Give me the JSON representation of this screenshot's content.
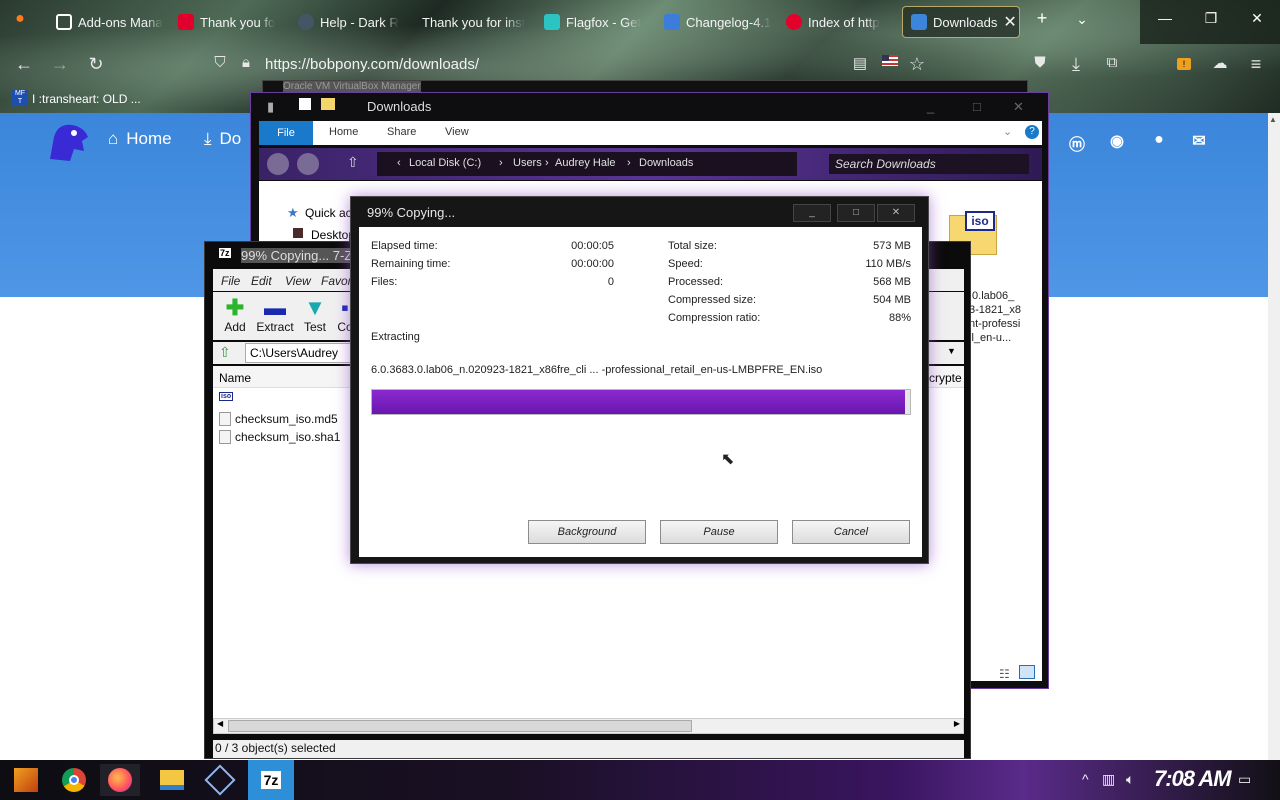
{
  "browser": {
    "tabs": [
      {
        "label": "Add-ons Mana",
        "icon": "puzzle-icon",
        "color": "#9aa0a6"
      },
      {
        "label": "Thank you fo",
        "icon": "shield-icon",
        "color": "#e0002b"
      },
      {
        "label": "Help - Dark R",
        "icon": "darkreader-icon",
        "color": "#556677"
      },
      {
        "label": "Thank you for inst",
        "icon": "blank-icon",
        "color": "transparent"
      },
      {
        "label": "Flagfox - Get",
        "icon": "fox-icon",
        "color": "#2cc3c3"
      },
      {
        "label": "Changelog-4.1",
        "icon": "image-icon",
        "color": "#3c7dd9"
      },
      {
        "label": "Index of http",
        "icon": "oracle-icon",
        "color": "#e4002b"
      },
      {
        "label": "Downloads",
        "icon": "bobpony-icon",
        "color": "#3b86db",
        "active": true
      }
    ],
    "url": "https://bobpony.com/downloads/",
    "bookmark": "I :transheart: OLD ...",
    "downloads_badge": "!"
  },
  "website": {
    "nav_home": "Home",
    "nav_downloads": "Do",
    "social": [
      "mastodon-icon",
      "discord-icon",
      "github-icon",
      "mail-icon"
    ]
  },
  "background_window": {
    "title": "Oracle VM VirtualBox Manager"
  },
  "explorer": {
    "title": "Downloads",
    "ribbon_tabs": [
      "File",
      "Home",
      "Share",
      "View"
    ],
    "breadcrumb": [
      "Local Disk (C:)",
      "Users",
      "Audrey Hale",
      "Downloads"
    ],
    "search_placeholder": "Search Downloads",
    "nav_items": [
      "Quick ac",
      "Desktop"
    ],
    "file_label_lines": [
      ".0.lab06_",
      "3-1821_x8",
      "nt-professi",
      "il_en-u..."
    ]
  },
  "sevenzip_fm": {
    "title": "99% Copying... 7-Z",
    "menu": [
      "File",
      "Edit",
      "View",
      "Favor"
    ],
    "tools": [
      "Add",
      "Extract",
      "Test",
      "Co"
    ],
    "path": "C:\\Users\\Audrey",
    "column_name": "Name",
    "column_right": "crypte",
    "files": [
      "checksum_iso.md5",
      "checksum_iso.sha1"
    ],
    "status": "0 / 3 object(s) selected"
  },
  "copy_dialog": {
    "title": "99% Copying...",
    "elapsed_label": "Elapsed time:",
    "elapsed_value": "00:00:05",
    "remaining_label": "Remaining time:",
    "remaining_value": "00:00:00",
    "files_label": "Files:",
    "files_value": "0",
    "total_label": "Total size:",
    "total_value": "573 MB",
    "speed_label": "Speed:",
    "speed_value": "110 MB/s",
    "processed_label": "Processed:",
    "processed_value": "568 MB",
    "compressed_label": "Compressed size:",
    "compressed_value": "504 MB",
    "ratio_label": "Compression ratio:",
    "ratio_value": "88%",
    "operation": "Extracting",
    "filename": "6.0.3683.0.lab06_n.020923-1821_x86fre_cli ... -professional_retail_en-us-LMBPFRE_EN.iso",
    "progress_fraction": 0.99,
    "btn_background": "Background",
    "btn_pause": "Pause",
    "btn_cancel": "Cancel"
  },
  "taskbar": {
    "apps": [
      "mft-icon",
      "chrome-icon",
      "firefox-icon",
      "file-explorer-icon",
      "virtualbox-icon",
      "7zip-icon"
    ],
    "clock": "7:08 AM",
    "sevenzip_label": "7z"
  }
}
